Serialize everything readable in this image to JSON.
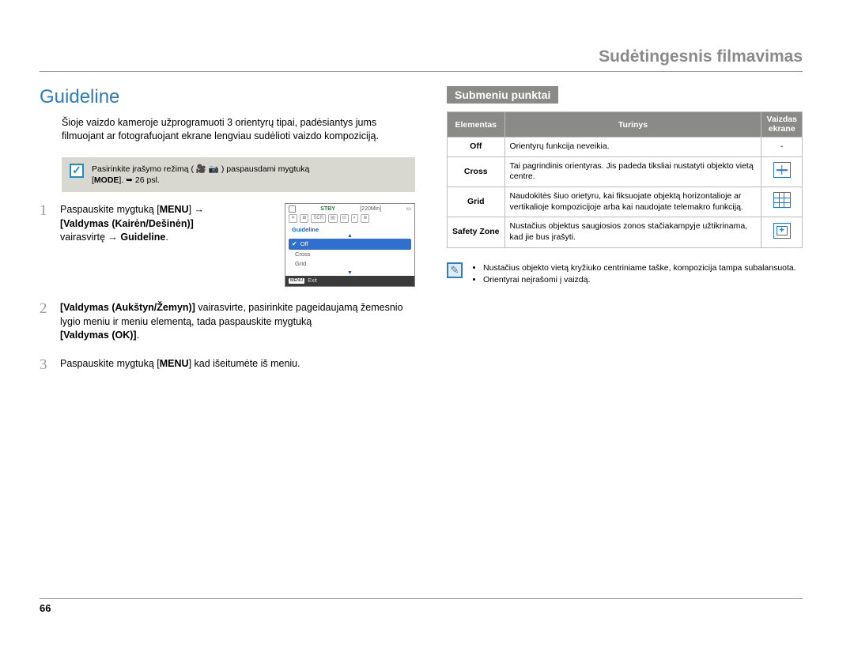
{
  "header": {
    "title": "Sudėtingesnis filmavimas"
  },
  "left": {
    "section_title": "Guideline",
    "intro": "Šioje vaizdo kameroje užprogramuoti 3 orientyrų tipai, padėsiantys jums filmuojant ar fotografuojant ekrane lengviau sudėlioti vaizdo kompoziciją.",
    "note": {
      "pre": "Pasirinkite įrašymo režimą ( ",
      "post": " ) paspausdami mygtuką",
      "line2a": "[",
      "mode": "MODE",
      "line2b": "]. ➥ 26 psl."
    },
    "steps": {
      "s1_a": "Paspauskite mygtuką [",
      "s1_menu": "MENU",
      "s1_b": "] → ",
      "s1_c": "[Valdymas (Kairėn/Dešinėn)]",
      "s1_d": " vairasvirtę → ",
      "s1_e": "Guideline",
      "s1_f": ".",
      "s2_a": "[Valdymas (Aukštyn/Žemyn)]",
      "s2_b": " vairasvirte, pasirinkite pageidaujamą žemesnio",
      "s2_c": "lygio meniu ir meniu elementą, tada paspauskite mygtuką ",
      "s2_d": "[Valdymas (OK)]",
      "s2_e": ".",
      "s3_a": "Paspauskite mygtuką [",
      "s3_menu": "MENU",
      "s3_b": "] kad išeitumėte iš meniu."
    },
    "lcd": {
      "stby": "STBY",
      "time": "[220Min]",
      "title": "Guideline",
      "items": [
        "Off",
        "Cross",
        "Grid"
      ],
      "exit": "Exit",
      "menu": "MENU"
    }
  },
  "right": {
    "subheader": "Submeniu punktai",
    "th1": "Elementas",
    "th2": "Turinys",
    "th3a": "Vaizdas",
    "th3b": "ekrane",
    "rows": [
      {
        "el": "Off",
        "desc": "Orientyrų funkcija neveikia.",
        "ic": "-"
      },
      {
        "el": "Cross",
        "desc": "Tai pagrindinis orientyras. Jis padeda tiksliai nustatyti objekto vietą centre."
      },
      {
        "el": "Grid",
        "desc": "Naudokitės šiuo orietyru, kai fiksuojate objektą horizontalioje ar vertikalioje kompozicijoje arba kai naudojate telemakro funkciją."
      },
      {
        "el": "Safety Zone",
        "desc": "Nustačius objektus saugiosios zonos stačiakampyje užtikrinama, kad jie bus įrašyti."
      }
    ],
    "tips": [
      "Nustačius objekto vietą kryžiuko centriniame taške, kompozicija tampa subalansuota.",
      "Orientyrai neįrašomi į vaizdą."
    ]
  },
  "page_number": "66"
}
